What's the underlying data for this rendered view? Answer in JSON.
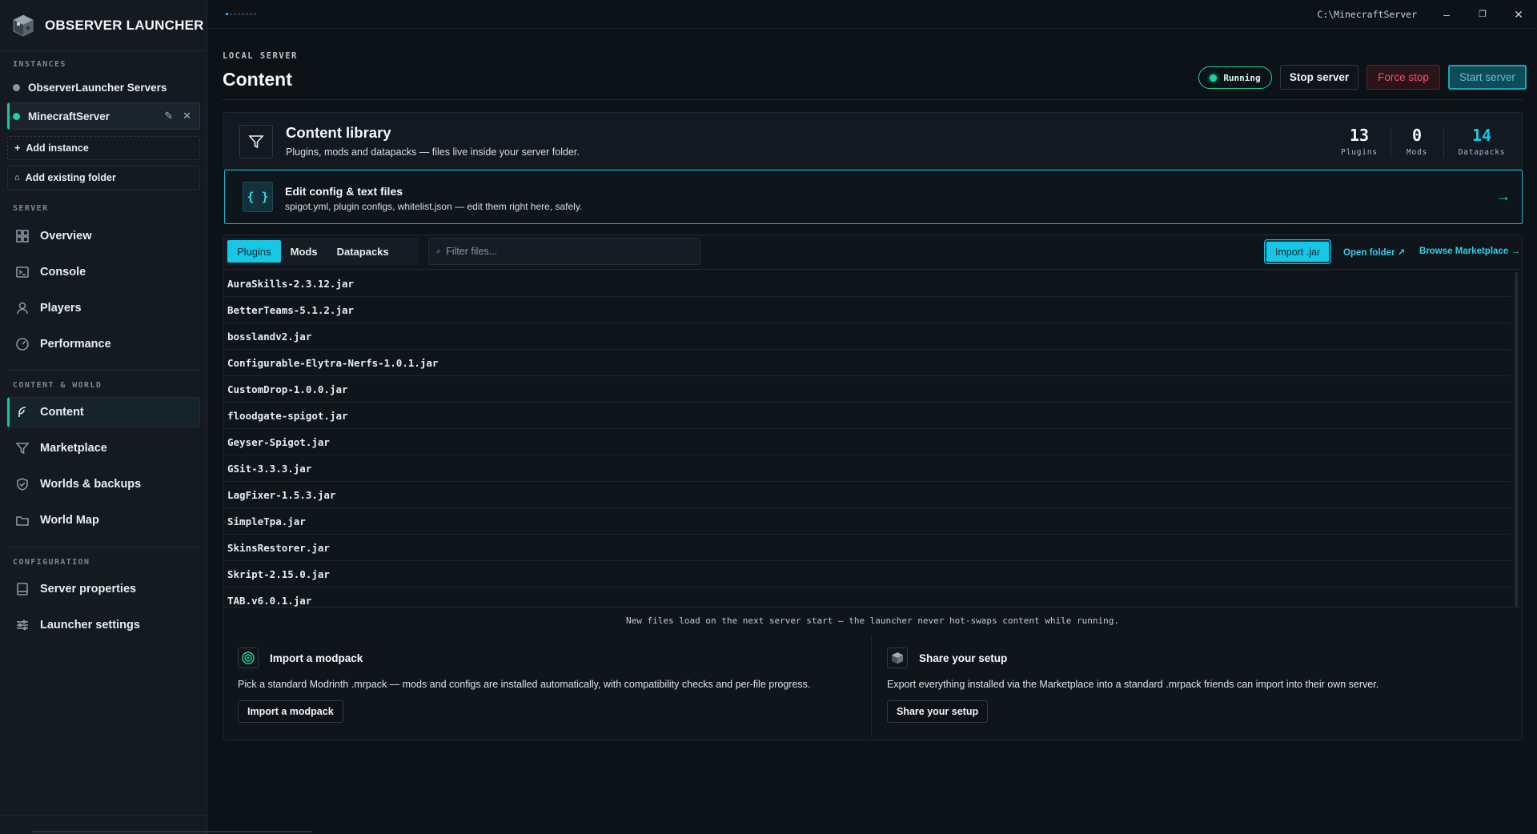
{
  "app": {
    "title": "OBSERVER LAUNCHER",
    "path": "C:\\MinecraftServer",
    "accent": "#16c7e6",
    "running_color": "#18d49e"
  },
  "sidebar": {
    "instances_label": "INSTANCES",
    "instances": [
      {
        "label": "ObserverLauncher Servers",
        "status_color": "#8b96a1"
      },
      {
        "label": "MinecraftServer",
        "status_color": "#18d49e",
        "active": true
      }
    ],
    "add_instance": "Add instance",
    "add_existing": "Add existing folder",
    "server_label": "SERVER",
    "server_items": [
      "Overview",
      "Console",
      "Players",
      "Performance"
    ],
    "content_label": "CONTENT & WORLD",
    "content_items": [
      "Content",
      "Marketplace",
      "Worlds & backups",
      "World Map"
    ],
    "config_label": "CONFIGURATION",
    "config_items": [
      "Server properties",
      "Launcher settings"
    ]
  },
  "header": {
    "eyebrow": "LOCAL SERVER",
    "title": "Content",
    "status": "Running",
    "stop": "Stop server",
    "force_stop": "Force stop",
    "start": "Start server"
  },
  "library": {
    "title": "Content library",
    "subtitle": "Plugins, mods and datapacks — files live inside your server folder.",
    "stats": [
      {
        "value": "13",
        "label": "Plugins"
      },
      {
        "value": "0",
        "label": "Mods"
      },
      {
        "value": "14",
        "label": "Datapacks"
      }
    ]
  },
  "config_banner": {
    "icon": "{ }",
    "title": "Edit config & text files",
    "subtitle": "spigot.yml, plugin configs, whitelist.json — edit them right here, safely.",
    "arrow": "→"
  },
  "files": {
    "tabs": [
      "Plugins",
      "Mods",
      "Datapacks"
    ],
    "active_tab": "Plugins",
    "filter_placeholder": "Filter files...",
    "import": "Import .jar",
    "open_folder": "Open folder ↗",
    "browse": "Browse Marketplace →",
    "list": [
      "AuraSkills-2.3.12.jar",
      "BetterTeams-5.1.2.jar",
      "bosslandv2.jar",
      "Configurable-Elytra-Nerfs-1.0.1.jar",
      "CustomDrop-1.0.0.jar",
      "floodgate-spigot.jar",
      "Geyser-Spigot.jar",
      "GSit-3.3.3.jar",
      "LagFixer-1.5.3.jar",
      "SimpleTpa.jar",
      "SkinsRestorer.jar",
      "Skript-2.15.0.jar",
      "TAB.v6.0.1.jar"
    ],
    "note": "New files load on the next server start — the launcher never hot-swaps content while running."
  },
  "modpack": {
    "title": "Import a modpack",
    "desc": "Pick a standard Modrinth .mrpack — mods and configs are installed automatically, with compatibility checks and per-file progress.",
    "button": "Import a modpack"
  },
  "share": {
    "title": "Share your setup",
    "desc": "Export everything installed via the Marketplace into a standard .mrpack friends can import into their own server.",
    "button": "Share your setup"
  }
}
